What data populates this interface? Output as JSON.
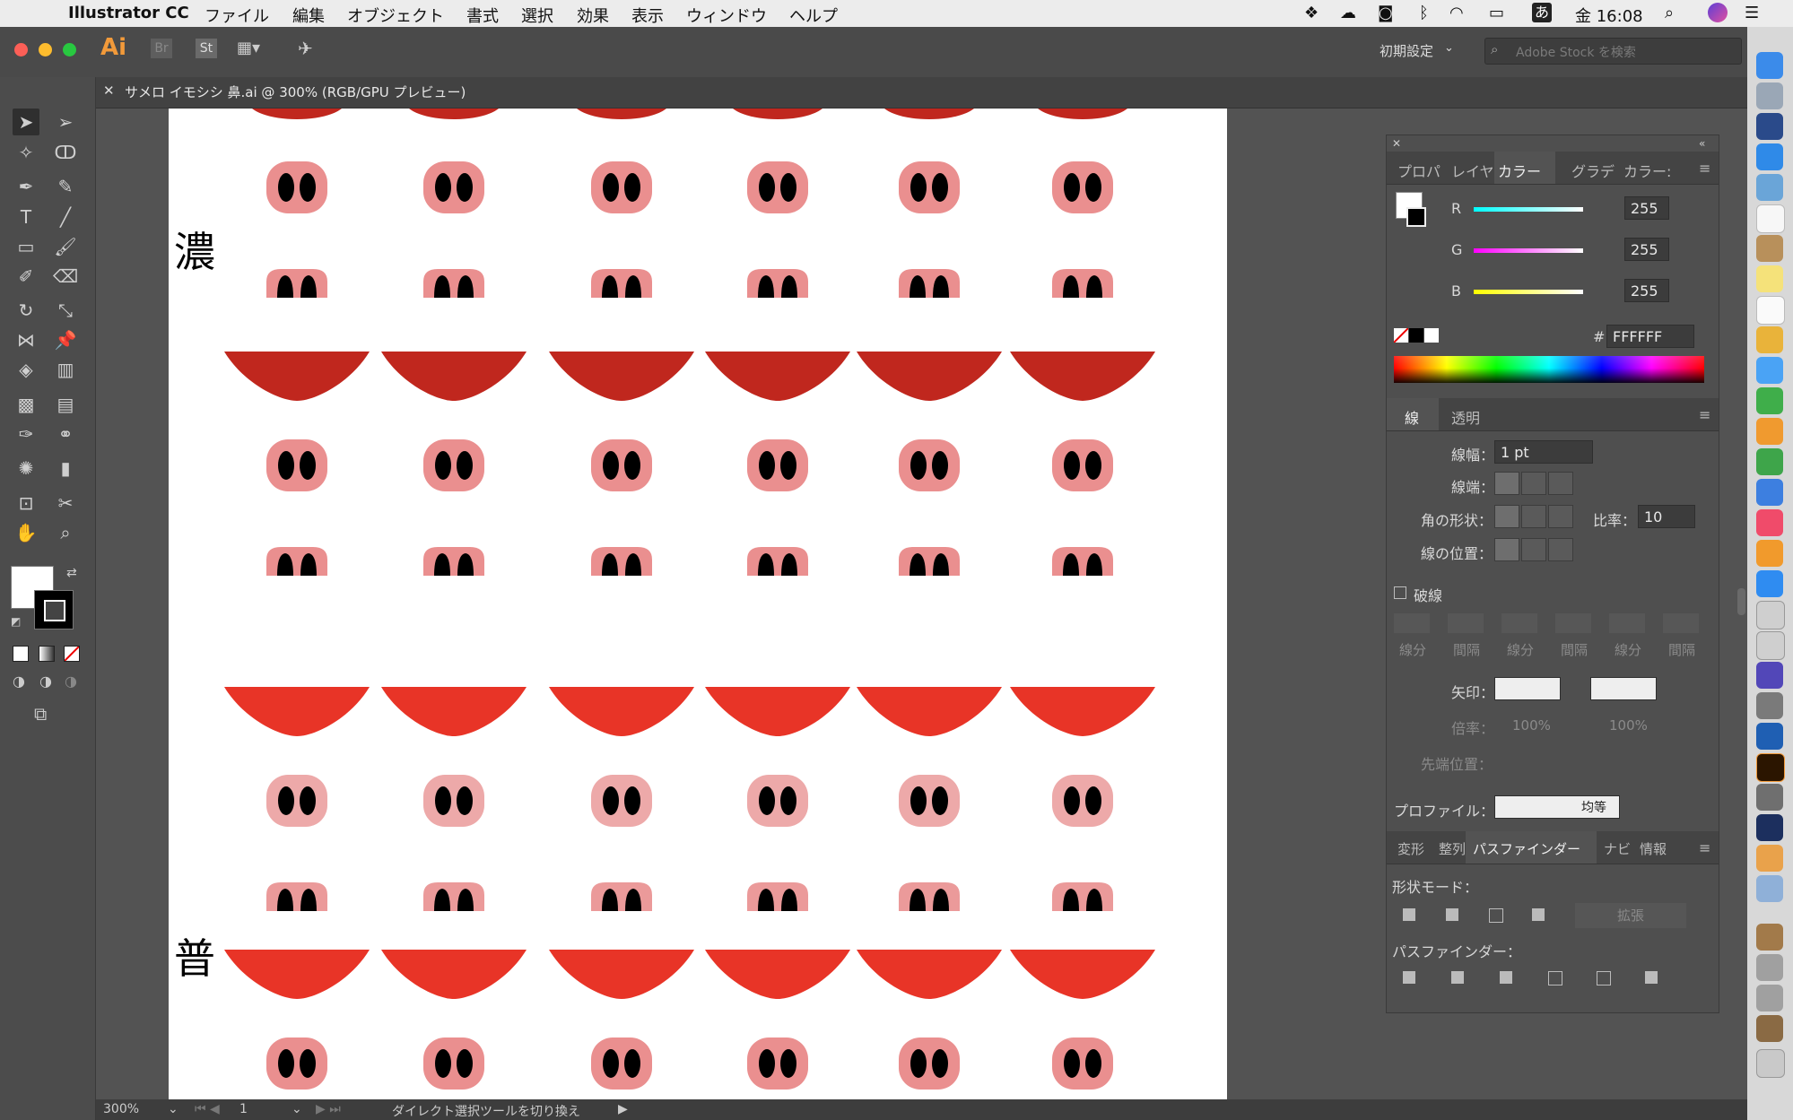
{
  "menubar": {
    "app_name": "Illustrator CC",
    "menus": [
      "ファイル",
      "編集",
      "オブジェクト",
      "書式",
      "選択",
      "効果",
      "表示",
      "ウィンドウ",
      "ヘルプ"
    ],
    "status_ime": "あ",
    "clock": "金 16:08"
  },
  "apptoolbar": {
    "ai_logo": "Ai",
    "br_label": "Br",
    "st_label": "St",
    "workspace": "初期設定",
    "search_placeholder": "Adobe Stock を検索"
  },
  "document": {
    "tab_title": "サメロ イモシシ 鼻.ai @ 300% (RGB/GPU プレビュー)"
  },
  "artboard": {
    "label_top": "濃",
    "label_bottom": "普"
  },
  "color_panel": {
    "tabs": [
      "プロパ",
      "レイヤ",
      "カラー",
      "グラデ",
      "カラー:"
    ],
    "r_label": "R",
    "r_value": "255",
    "g_label": "G",
    "g_value": "255",
    "b_label": "B",
    "b_value": "255",
    "hex_label": "#",
    "hex_value": "FFFFFF"
  },
  "stroke_panel": {
    "tabs": [
      "線",
      "透明"
    ],
    "weight_label": "線幅：",
    "weight_value": "1 pt",
    "cap_label": "線端：",
    "corner_label": "角の形状：",
    "limit_label": "比率：",
    "limit_value": "10",
    "align_label": "線の位置：",
    "dashed_label": "破線",
    "dash_cols": [
      "線分",
      "間隔",
      "線分",
      "間隔",
      "線分",
      "間隔"
    ],
    "arrow_label": "矢印：",
    "scale_label": "倍率：",
    "scale_value_1": "100%",
    "scale_value_2": "100%",
    "tip_label": "先端位置：",
    "profile_label": "プロファイル：",
    "profile_value": "均等"
  },
  "pathfinder_panel": {
    "tabs": [
      "変形",
      "整列",
      "パスファインダー",
      "ナビ",
      "情報"
    ],
    "shape_modes_label": "形状モード：",
    "expand_label": "拡張",
    "pathfinders_label": "パスファインダー："
  },
  "statusbar": {
    "zoom": "300%",
    "artboard_num": "1",
    "status_text": "ダイレクト選択ツールを切り換え"
  },
  "colors": {
    "mouth_dark": "#c0271e",
    "mouth_normal": "#e83427",
    "nose_dark": "#ea8f8f",
    "nose_mid": "#eb9a9a",
    "nose_light": "#eda9a9"
  }
}
